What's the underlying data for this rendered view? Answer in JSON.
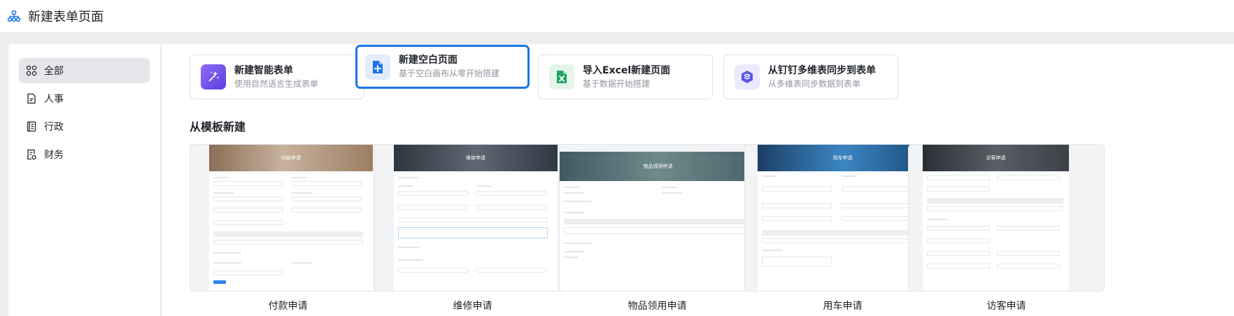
{
  "header": {
    "title": "新建表单页面",
    "logo_icon": "org-chart-icon"
  },
  "sidebar": {
    "items": [
      {
        "label": "全部",
        "icon": "grid-icon",
        "active": true
      },
      {
        "label": "人事",
        "icon": "document-icon",
        "active": false
      },
      {
        "label": "行政",
        "icon": "book-icon",
        "active": false
      },
      {
        "label": "财务",
        "icon": "finance-doc-icon",
        "active": false
      }
    ]
  },
  "create_options": [
    {
      "title": "新建智能表单",
      "subtitle": "使用自然语言生成表单",
      "icon": "magic-wand-icon",
      "color": "#7b5cf0"
    },
    {
      "title": "新建空白页面",
      "subtitle": "基于空白画布从零开始搭建",
      "icon": "blank-page-plus-icon",
      "color": "#1b73e8",
      "selected": true
    },
    {
      "title": "导入Excel新建页面",
      "subtitle": "基于数据开始搭建",
      "icon": "excel-icon",
      "color": "#1fa463"
    },
    {
      "title": "从钉钉多维表同步到表单",
      "subtitle": "从多维表同步数据到表单",
      "icon": "multi-table-sync-icon",
      "color": "#5b52e8"
    }
  ],
  "templates_section": {
    "title": "从模板新建"
  },
  "templates": [
    {
      "name": "付款申请",
      "banner_text": "付款申请",
      "banner_color": "#b49c86"
    },
    {
      "name": "维修申请",
      "banner_text": "维修申请",
      "banner_color": "#3d4a55"
    },
    {
      "name": "物品领用申请",
      "banner_text": "物品领用申请",
      "banner_color": "#4d6a72"
    },
    {
      "name": "用车申请",
      "banner_text": "用车申请",
      "banner_color": "#2c6fa8"
    },
    {
      "name": "访客申请",
      "banner_text": "访客申请",
      "banner_color": "#3a3f47"
    }
  ]
}
